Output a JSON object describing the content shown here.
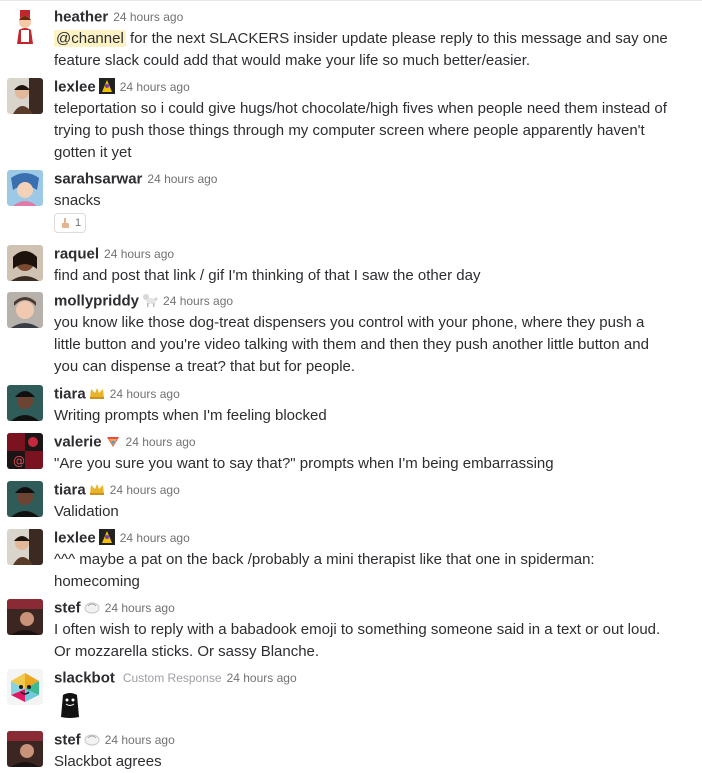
{
  "messages": [
    {
      "user": "heather",
      "time": "24 hours ago",
      "mention": "@channel",
      "text": "for the next SLACKERS insider update please reply to this message and say one feature slack could add that would make your life so much better/easier."
    },
    {
      "user": "lexlee",
      "time": "24 hours ago",
      "text": "teleportation so i could give hugs/hot chocolate/high fives when people need them instead of trying to push those things through my computer screen where people apparently haven't gotten it yet"
    },
    {
      "user": "sarahsarwar",
      "time": "24 hours ago",
      "text": "snacks",
      "reaction": {
        "icon": "point-up-emoji",
        "count": "1"
      }
    },
    {
      "user": "raquel",
      "time": "24 hours ago",
      "text": "find and post that link / gif I'm thinking of that I saw the other day"
    },
    {
      "user": "mollypriddy",
      "time": "24 hours ago",
      "text": "you know like those dog-treat dispensers you control with your phone, where they push a little button and you're video talking with them and then they push another little button and you can dispense a treat? that but for people."
    },
    {
      "user": "tiara",
      "time": "24 hours ago",
      "text": "Writing prompts when I'm feeling blocked"
    },
    {
      "user": "valerie",
      "time": "24 hours ago",
      "text": "\"Are you sure you want to say that?\" prompts when I'm being embarrassing"
    },
    {
      "user": "tiara",
      "time": "24 hours ago",
      "text": "Validation"
    },
    {
      "user": "lexlee",
      "time": "24 hours ago",
      "text": "^^^ maybe a pat on the back /probably a mini therapist like that one in spiderman: homecoming"
    },
    {
      "user": "stef",
      "time": "24 hours ago",
      "text": "I often wish to reply with a babadook emoji to something someone said in a text or out loud. Or mozzarella sticks. Or sassy Blanche."
    },
    {
      "user": "slackbot",
      "tag": "Custom Response",
      "time": "24 hours ago",
      "image": "babadook-image"
    },
    {
      "user": "stef",
      "time": "24 hours ago",
      "text": "Slackbot agrees"
    }
  ],
  "colors": {
    "mention_bg": "#fcf2c4",
    "name": "#2c2d30",
    "timestamp": "#717274"
  }
}
